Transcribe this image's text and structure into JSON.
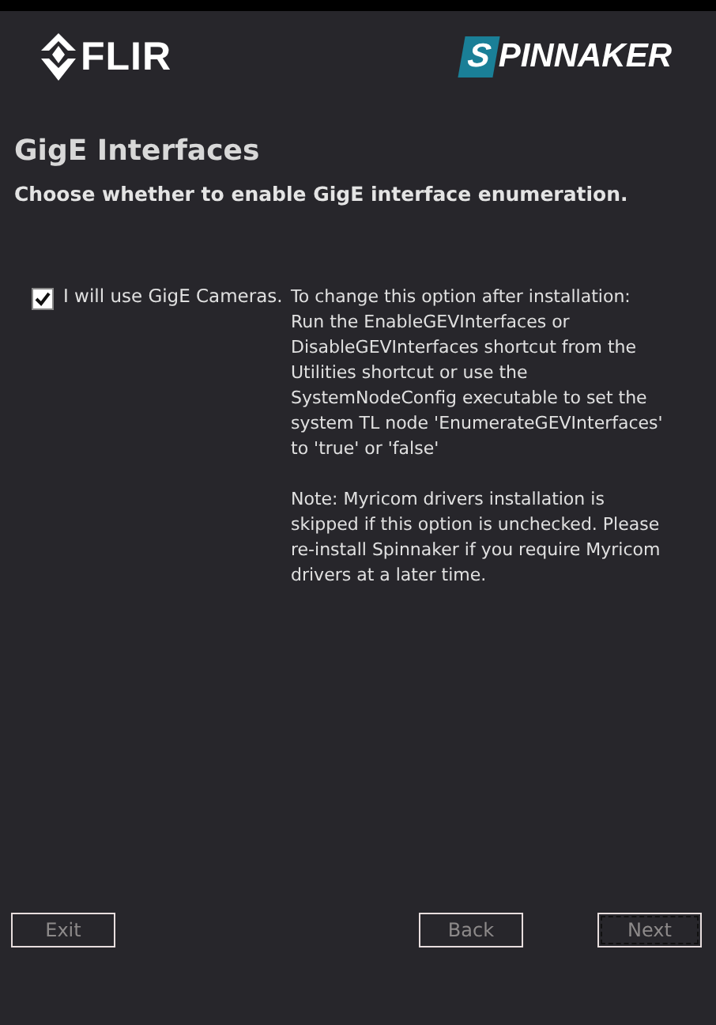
{
  "header": {
    "flir_logo": "FLIR",
    "spinnaker_logo": "SPINNAKER"
  },
  "title": "GigE Interfaces",
  "subtitle": "Choose whether to enable GigE interface enumeration.",
  "option": {
    "label": "I will use GigE Cameras.",
    "checked": true
  },
  "notes": [
    "To change this option after installation:\nRun the EnableGEVInterfaces or\nDisableGEVInterfaces shortcut from the\nUtilities shortcut or use the\nSystemNodeConfig executable to set the\nsystem TL node 'EnumerateGEVInterfaces'\nto 'true' or 'false'",
    "Note: Myricom drivers installation is\nskipped if this option is unchecked. Please\nre-install Spinnaker if you require Myricom\ndrivers at a later time."
  ],
  "buttons": [
    {
      "label": "Exit",
      "focused": false
    },
    {
      "label": "Back",
      "focused": false
    },
    {
      "label": "Next",
      "focused": true
    }
  ]
}
